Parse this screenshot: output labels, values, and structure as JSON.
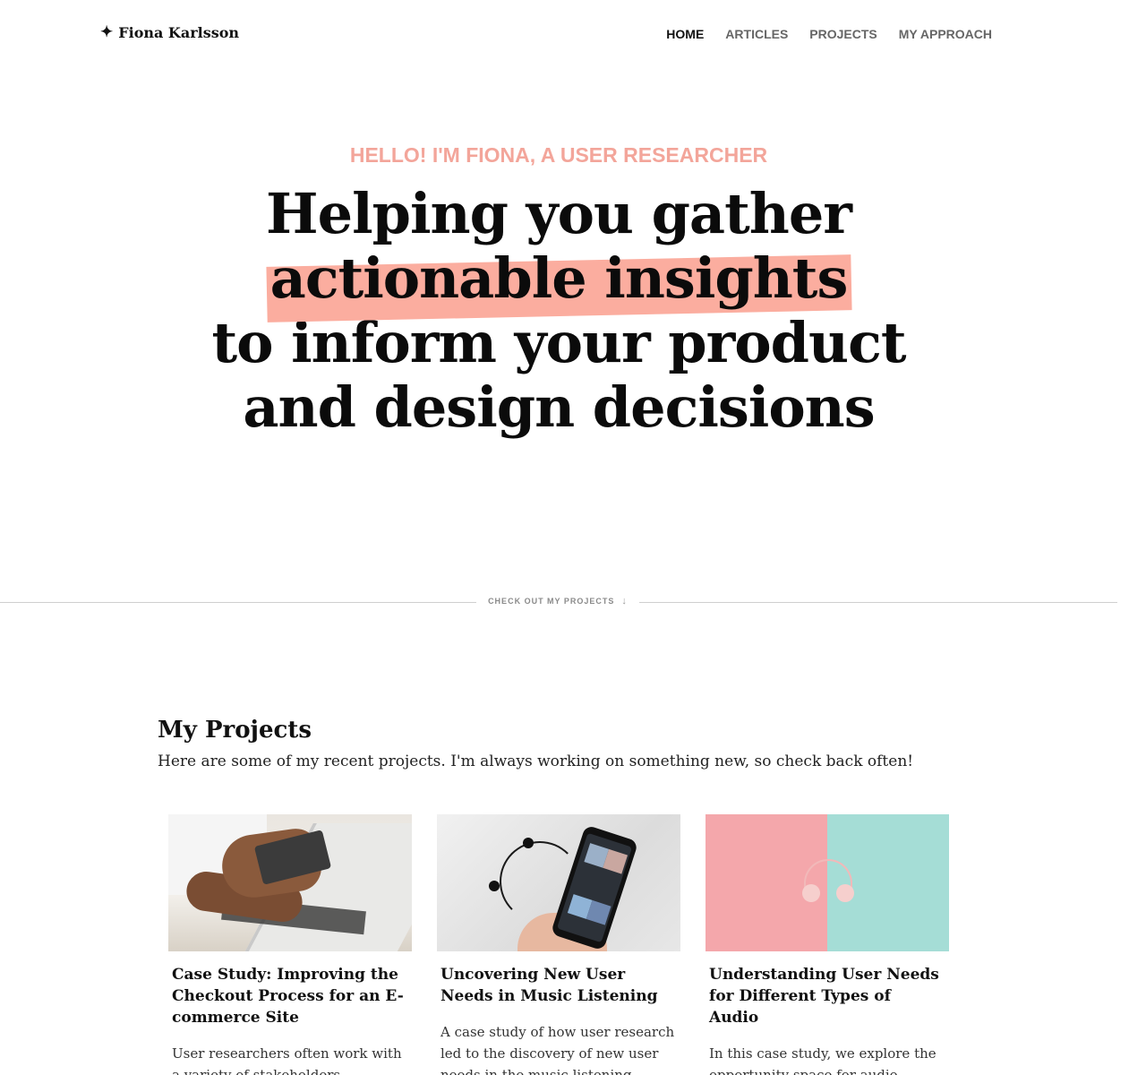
{
  "header": {
    "brand_icon": "star-icon",
    "brand_name": "Fiona Karlsson",
    "nav": [
      {
        "label": "HOME",
        "active": true
      },
      {
        "label": "ARTICLES",
        "active": false
      },
      {
        "label": "PROJECTS",
        "active": false
      },
      {
        "label": "MY APPROACH",
        "active": false
      }
    ]
  },
  "hero": {
    "eyebrow": "HELLO! I'M FIONA, A USER RESEARCHER",
    "line1": "Helping you gather",
    "line2_highlight": "actionable insights",
    "line3": "to inform your product",
    "line4": "and design decisions",
    "highlight_color": "#fbad9f",
    "eyebrow_color": "#f3a59a"
  },
  "divider": {
    "label": "CHECK OUT MY PROJECTS",
    "icon": "arrow-down-icon"
  },
  "projects": {
    "title": "My Projects",
    "intro": "Here are some of my recent projects. I'm always working on something new, so check back often!",
    "cards": [
      {
        "title": "Case Study: Improving the Checkout Process for an E-commerce Site",
        "excerpt": "User researchers often work with a variety of stakeholders, including",
        "image": "laptop-credit-card-photo"
      },
      {
        "title": "Uncovering New User Needs in Music Listening",
        "excerpt": "A case study of how user research led to the discovery of new user needs in the music listening experience, and",
        "image": "phone-music-app-photo"
      },
      {
        "title": "Understanding User Needs for Different Types of Audio",
        "excerpt": "In this case study, we explore the opportunity space for audio products and services by understanding the",
        "image": "headphones-pink-teal-photo"
      }
    ]
  }
}
